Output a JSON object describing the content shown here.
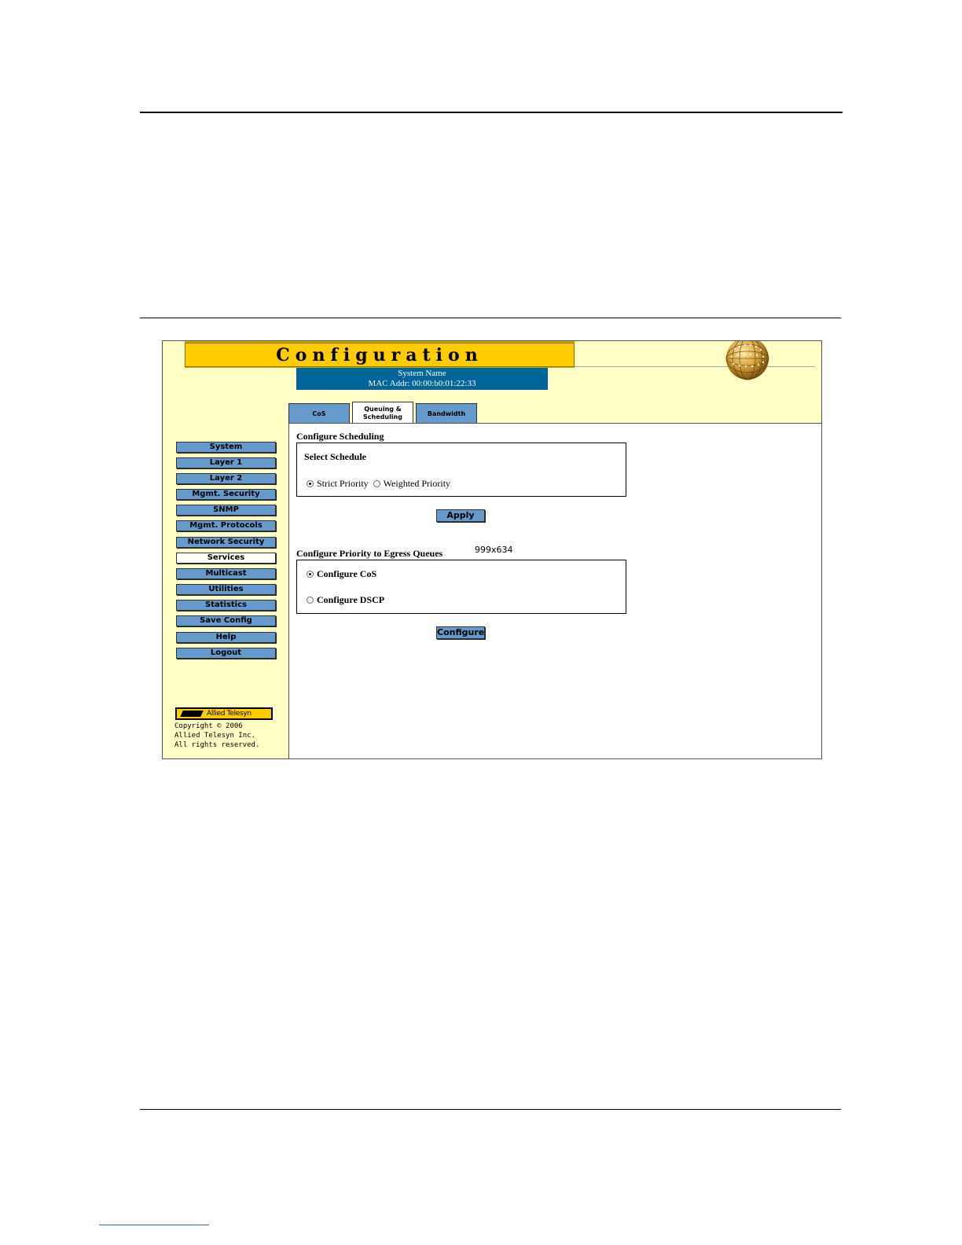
{
  "banner": {
    "title": "Configuration"
  },
  "system_info": {
    "system_name": "System Name",
    "mac_addr": "MAC Addr:  00:00:b0:01:22:33"
  },
  "tabs": [
    {
      "label": "CoS",
      "active": false
    },
    {
      "label": "Queuing & Scheduling",
      "active": true
    },
    {
      "label": "Bandwidth",
      "active": false
    }
  ],
  "nav": {
    "items": [
      {
        "label": "System",
        "active": false
      },
      {
        "label": "Layer 1",
        "active": false
      },
      {
        "label": "Layer 2",
        "active": false
      },
      {
        "label": "Mgmt. Security",
        "active": false
      },
      {
        "label": "SNMP",
        "active": false
      },
      {
        "label": "Mgmt. Protocols",
        "active": false
      },
      {
        "label": "Network Security",
        "active": false
      },
      {
        "label": "Services",
        "active": true
      },
      {
        "label": "Multicast",
        "active": false
      },
      {
        "label": "Utilities",
        "active": false
      },
      {
        "label": "Statistics",
        "active": false
      },
      {
        "label": "Save Config",
        "active": false
      },
      {
        "label": "Help",
        "active": false
      },
      {
        "label": "Logout",
        "active": false
      }
    ]
  },
  "brand": {
    "logo_text": "Allied Telesyn",
    "copyright_line1": "Copyright © 2006",
    "copyright_line2": "Allied Telesyn Inc.",
    "copyright_line3": "All rights reserved."
  },
  "scheduling": {
    "title": "Configure Scheduling",
    "box_label": "Select Schedule",
    "options": [
      {
        "label": "Strict Priority",
        "checked": true
      },
      {
        "label": "Weighted Priority",
        "checked": false
      }
    ],
    "apply_label": "Apply"
  },
  "egress": {
    "title": "Configure Priority to Egress Queues",
    "dimension_note": "999x634",
    "options": [
      {
        "label": "Configure CoS",
        "checked": true
      },
      {
        "label": "Configure DSCP",
        "checked": false
      }
    ],
    "configure_label": "Configure"
  },
  "colors": {
    "page_bg": "#ffffc6",
    "banner": "#ffcc00",
    "sysinfo_bg": "#006699",
    "button": "#6699cc"
  }
}
